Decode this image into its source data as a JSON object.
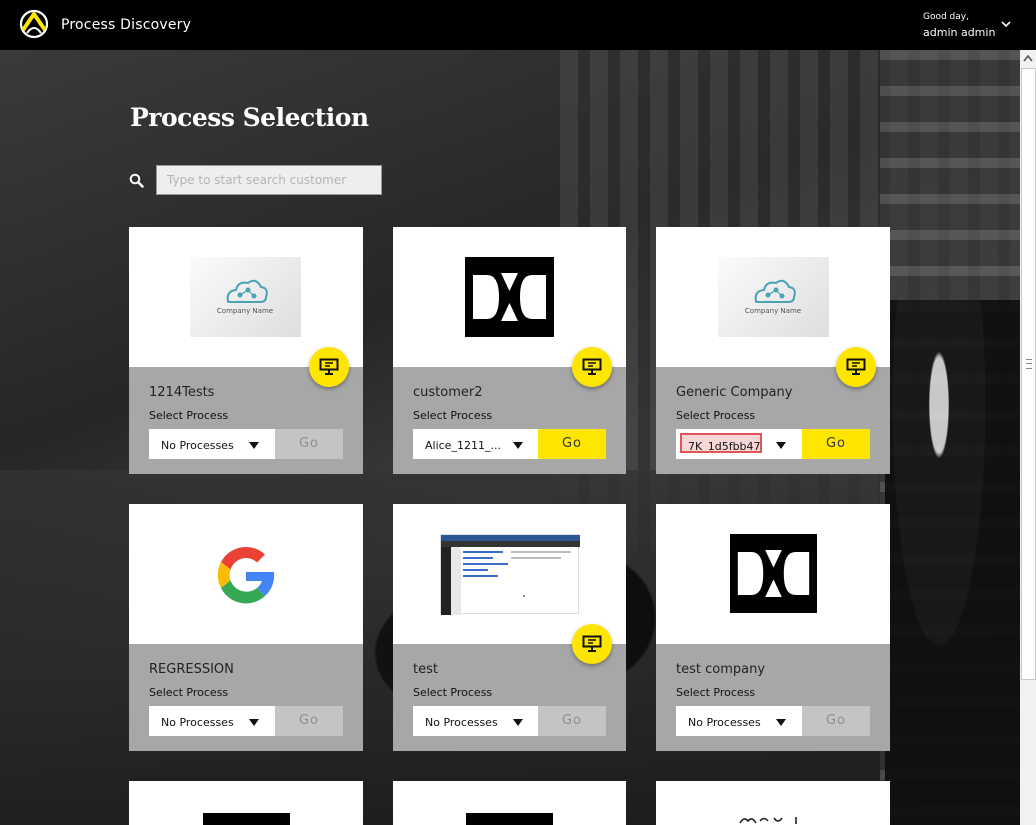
{
  "app": {
    "title": "Process Discovery"
  },
  "user": {
    "greeting": "Good day,",
    "name": "admin admin"
  },
  "page": {
    "title": "Process Selection"
  },
  "search": {
    "placeholder": "Type to start search customer",
    "value": ""
  },
  "cards": [
    {
      "name": "1214Tests",
      "select_label": "Select Process",
      "process": "No Processes",
      "go": "Go",
      "go_enabled": false,
      "logo": "company-name-cloud-logo",
      "logo_text": "Company Name",
      "has_screen_badge": true
    },
    {
      "name": "customer2",
      "select_label": "Select Process",
      "process": "Alice_1211_...",
      "go": "Go",
      "go_enabled": true,
      "logo": "dxc-logo",
      "has_screen_badge": true
    },
    {
      "name": "Generic Company",
      "select_label": "Select Process",
      "process": "7K_1d5fbb47",
      "go": "Go",
      "go_enabled": true,
      "logo": "company-name-cloud-logo",
      "logo_text": "Company Name",
      "has_screen_badge": true,
      "process_highlight": true
    },
    {
      "name": "REGRESSION",
      "select_label": "Select Process",
      "process": "No Processes",
      "go": "Go",
      "go_enabled": false,
      "logo": "google-g-logo",
      "has_screen_badge": false
    },
    {
      "name": "test",
      "select_label": "Select Process",
      "process": "No Processes",
      "go": "Go",
      "go_enabled": false,
      "logo": "screenshot-thumbnail",
      "has_screen_badge": true
    },
    {
      "name": "test company",
      "select_label": "Select Process",
      "process": "No Processes",
      "go": "Go",
      "go_enabled": false,
      "logo": "dxc-logo",
      "has_screen_badge": false
    }
  ],
  "colors": {
    "accent": "#ffe600",
    "topbar": "#000000",
    "card_bottom": "#a7a7a7",
    "disabled": "#c4c4c4"
  }
}
